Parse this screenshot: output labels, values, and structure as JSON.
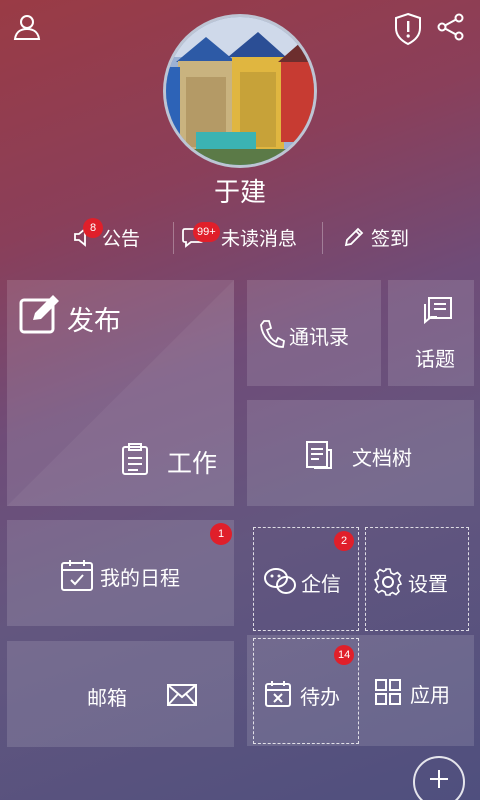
{
  "header": {
    "user_name": "于建"
  },
  "actions": {
    "announcement": {
      "label": "公告",
      "badge": "8"
    },
    "messages": {
      "label": "未读消息",
      "badge": "99+"
    },
    "checkin": {
      "label": "签到"
    }
  },
  "tiles": {
    "publish": "发布",
    "work": "工作",
    "contacts": "通讯录",
    "topics": "话题",
    "doc_tree": "文档树",
    "schedule": {
      "label": "我的日程",
      "badge": "1"
    },
    "enterprise_msg": {
      "label": "企信",
      "badge": "2"
    },
    "settings": "设置",
    "mail": "邮箱",
    "todo": {
      "label": "待办",
      "badge": "14"
    },
    "apps": "应用"
  },
  "icons": [
    "user-icon",
    "shield-icon",
    "share-icon",
    "speaker-icon",
    "chat-icon",
    "pen-icon",
    "edit-icon",
    "clipboard-icon",
    "phone-icon",
    "topic-icon",
    "document-icon",
    "calendar-check-icon",
    "wechat-icon",
    "gear-icon",
    "mail-icon",
    "calendar-x-icon",
    "grid-icon",
    "plus-icon"
  ],
  "colors": {
    "badge": "#e01f2a",
    "background_top": "#9a3b45",
    "background_bottom": "#4f4f7e"
  }
}
